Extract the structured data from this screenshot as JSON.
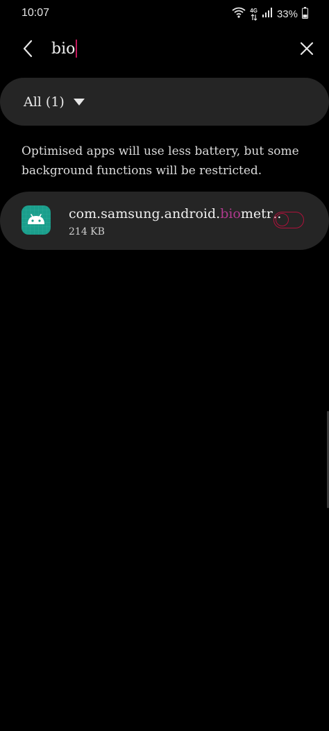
{
  "status_bar": {
    "time": "10:07",
    "network": "4G",
    "battery_percent": "33%",
    "icons": [
      "wifi-icon",
      "mobile-data-icon",
      "signal-icon",
      "battery-icon"
    ]
  },
  "search": {
    "query": "bio",
    "back_icon": "back-arrow-icon",
    "close_icon": "close-icon"
  },
  "filter": {
    "label": "All (1)",
    "icon": "dropdown-triangle-icon"
  },
  "info": {
    "text": "Optimised apps will use less battery, but some background functions will be restricted."
  },
  "app_list": [
    {
      "name_prefix": "com.samsung.android.",
      "name_highlight": "bio",
      "name_suffix": "metr‥",
      "size": "214 KB",
      "icon": "android-icon",
      "optimised": false
    }
  ],
  "colors": {
    "background": "#000000",
    "card": "#252525",
    "highlight": "#b03a8e",
    "accent": "#b0113b",
    "icon_bg": "#1a9e8c"
  }
}
